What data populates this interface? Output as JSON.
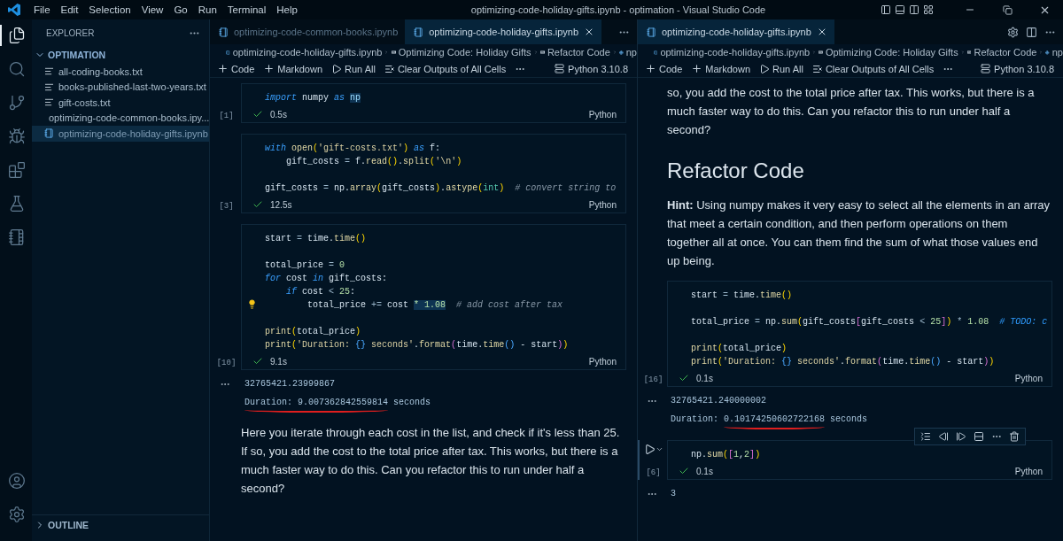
{
  "title_bar": {
    "menu": [
      "File",
      "Edit",
      "Selection",
      "View",
      "Go",
      "Run",
      "Terminal",
      "Help"
    ],
    "title": "optimizing-code-holiday-gifts.ipynb - optimation - Visual Studio Code"
  },
  "activity_bar": {
    "items": [
      {
        "kind": "explorer",
        "selected": true
      },
      {
        "kind": "search",
        "selected": false
      },
      {
        "kind": "source_control",
        "selected": false
      },
      {
        "kind": "debug",
        "selected": false
      },
      {
        "kind": "extensions",
        "selected": false
      },
      {
        "kind": "testing",
        "selected": false
      },
      {
        "kind": "notebook",
        "selected": false
      }
    ],
    "bottom": [
      {
        "kind": "account"
      },
      {
        "kind": "settings"
      }
    ]
  },
  "sidebar": {
    "title": "EXPLORER",
    "folder": {
      "name": "OPTIMATION",
      "expanded": true,
      "children": [
        {
          "name": "all-coding-books.txt",
          "kind": "text",
          "selected": false
        },
        {
          "name": "books-published-last-two-years.txt",
          "kind": "text",
          "selected": false
        },
        {
          "name": "gift-costs.txt",
          "kind": "text",
          "selected": false
        },
        {
          "name": "optimizing-code-common-books.ipy...",
          "kind": "notebook",
          "selected": false
        },
        {
          "name": "optimizing-code-holiday-gifts.ipynb",
          "kind": "notebook",
          "selected": true
        }
      ]
    },
    "sections": [
      {
        "name": "OUTLINE",
        "expanded": false
      }
    ]
  },
  "editor_groups": [
    {
      "tabs": [
        {
          "label": "optimizing-code-common-books.ipynb",
          "selected": false
        },
        {
          "label": "optimizing-code-holiday-gifts.ipynb",
          "selected": true
        }
      ],
      "tab_actions": [
        {
          "kind": "more"
        }
      ],
      "breadcrumbs": [
        {
          "label": "optimizing-code-holiday-gifts.ipynb",
          "kind": "file"
        },
        {
          "label": "Optimizing Code: Holiday Gifts",
          "kind": "markdown"
        },
        {
          "label": "Refactor Code",
          "kind": "markdown"
        },
        {
          "label": "np",
          "kind": "python"
        }
      ],
      "toolbar": {
        "buttons": [
          {
            "label": "Code",
            "kind": "add"
          },
          {
            "label": "Markdown",
            "kind": "add"
          },
          {
            "label": "Run All",
            "kind": "run"
          },
          {
            "label": "Clear Outputs of All Cells",
            "kind": "clear"
          }
        ],
        "kernel": "Python 3.10.8"
      },
      "cells": [
        {
          "kind": "code",
          "focused": false,
          "execution": "[1]",
          "status": "0.5s",
          "language": "Python",
          "lines": [
            {
              "kind": "code",
              "tokens": [
                {
                  "text": "import ",
                  "kind": "kw"
                },
                {
                  "text": "numpy ",
                  "kind": "p"
                },
                {
                  "text": "as ",
                  "kind": "kw"
                },
                {
                  "text": "np",
                  "kind": "var",
                  "highlighted": true
                }
              ]
            }
          ]
        },
        {
          "kind": "code",
          "focused": false,
          "execution": "[3]",
          "status": "12.5s",
          "language": "Python",
          "lines": [
            {
              "kind": "code",
              "tokens": [
                {
                  "text": "with ",
                  "kind": "kw"
                },
                {
                  "text": "open",
                  "kind": "fn"
                },
                {
                  "text": "(",
                  "kind": "br"
                },
                {
                  "text": "'gift-costs.txt'",
                  "kind": "str"
                },
                {
                  "text": ") ",
                  "kind": "br"
                },
                {
                  "text": "as ",
                  "kind": "kw"
                },
                {
                  "text": "f:",
                  "kind": "p"
                }
              ]
            },
            {
              "kind": "code",
              "tokens": [
                {
                  "text": "    gift_costs ",
                  "kind": "p"
                },
                {
                  "text": "=",
                  "kind": "op"
                },
                {
                  "text": " f.",
                  "kind": "p"
                },
                {
                  "text": "read",
                  "kind": "fn"
                },
                {
                  "text": "()",
                  "kind": "br"
                },
                {
                  "text": ".",
                  "kind": "p"
                },
                {
                  "text": "split",
                  "kind": "fn"
                },
                {
                  "text": "(",
                  "kind": "br"
                },
                {
                  "text": "'\\n'",
                  "kind": "str"
                },
                {
                  "text": ")",
                  "kind": "br"
                }
              ]
            },
            {
              "kind": "blank"
            },
            {
              "kind": "code",
              "tokens": [
                {
                  "text": "gift_costs ",
                  "kind": "p"
                },
                {
                  "text": "=",
                  "kind": "op"
                },
                {
                  "text": " np.",
                  "kind": "p"
                },
                {
                  "text": "array",
                  "kind": "fn"
                },
                {
                  "text": "(",
                  "kind": "br"
                },
                {
                  "text": "gift_costs",
                  "kind": "p"
                },
                {
                  "text": ")",
                  "kind": "br"
                },
                {
                  "text": ".",
                  "kind": "p"
                },
                {
                  "text": "astype",
                  "kind": "fn"
                },
                {
                  "text": "(",
                  "kind": "br"
                },
                {
                  "text": "int",
                  "kind": "cls"
                },
                {
                  "text": ")",
                  "kind": "br"
                },
                {
                  "text": "  # convert string to",
                  "kind": "com"
                }
              ]
            }
          ]
        },
        {
          "kind": "code",
          "focused": false,
          "execution": "[10]",
          "status": "9.1s",
          "language": "Python",
          "lines": [
            {
              "kind": "code",
              "tokens": [
                {
                  "text": "start ",
                  "kind": "p"
                },
                {
                  "text": "=",
                  "kind": "op"
                },
                {
                  "text": " time.",
                  "kind": "p"
                },
                {
                  "text": "time",
                  "kind": "fn"
                },
                {
                  "text": "()",
                  "kind": "br"
                }
              ]
            },
            {
              "kind": "blank"
            },
            {
              "kind": "code",
              "tokens": [
                {
                  "text": "total_price ",
                  "kind": "p"
                },
                {
                  "text": "=",
                  "kind": "op"
                },
                {
                  "text": " 0",
                  "kind": "num"
                }
              ]
            },
            {
              "kind": "code",
              "tokens": [
                {
                  "text": "for ",
                  "kind": "kw"
                },
                {
                  "text": "cost ",
                  "kind": "p"
                },
                {
                  "text": "in ",
                  "kind": "kw"
                },
                {
                  "text": "gift_costs:",
                  "kind": "p"
                }
              ]
            },
            {
              "kind": "code",
              "tokens": [
                {
                  "text": "    if ",
                  "kind": "kw"
                },
                {
                  "text": "cost ",
                  "kind": "p"
                },
                {
                  "text": "<",
                  "kind": "op"
                },
                {
                  "text": " 25",
                  "kind": "num"
                },
                {
                  "text": ":",
                  "kind": "p"
                }
              ]
            },
            {
              "kind": "code",
              "lightbulb": true,
              "tokens": [
                {
                  "text": "        total_price ",
                  "kind": "p"
                },
                {
                  "text": "+=",
                  "kind": "op"
                },
                {
                  "text": " cost ",
                  "kind": "p"
                },
                {
                  "text": "* 1.08",
                  "kind": "num",
                  "highlighted": true
                },
                {
                  "text": "  # add cost after tax",
                  "kind": "com"
                }
              ]
            },
            {
              "kind": "blank"
            },
            {
              "kind": "code",
              "tokens": [
                {
                  "text": "print",
                  "kind": "fn"
                },
                {
                  "text": "(",
                  "kind": "br"
                },
                {
                  "text": "total_price",
                  "kind": "p"
                },
                {
                  "text": ")",
                  "kind": "br"
                }
              ]
            },
            {
              "kind": "code",
              "tokens": [
                {
                  "text": "print",
                  "kind": "fn"
                },
                {
                  "text": "(",
                  "kind": "br"
                },
                {
                  "text": "'Duration: ",
                  "kind": "str"
                },
                {
                  "text": "{}",
                  "kind": "br3"
                },
                {
                  "text": " seconds'",
                  "kind": "str"
                },
                {
                  "text": ".",
                  "kind": "p"
                },
                {
                  "text": "format",
                  "kind": "fn"
                },
                {
                  "text": "(",
                  "kind": "br2"
                },
                {
                  "text": "time.",
                  "kind": "p"
                },
                {
                  "text": "time",
                  "kind": "fn"
                },
                {
                  "text": "()",
                  "kind": "br3"
                },
                {
                  "text": " - start",
                  "kind": "p"
                },
                {
                  "text": ")",
                  "kind": "br2"
                },
                {
                  "text": ")",
                  "kind": "br"
                }
              ]
            }
          ],
          "outputs": [
            {
              "segments": [
                {
                  "text": "32765421.23999867",
                  "underlined": false
                }
              ]
            },
            {
              "segments": [
                {
                  "text": "Duration: 9.007362842559814",
                  "underlined": true
                },
                {
                  "text": " seconds",
                  "underlined": false
                }
              ]
            }
          ]
        },
        {
          "kind": "markdown",
          "blocks": [
            {
              "kind": "paragraph",
              "text": "Here you iterate through each cost in the list, and check if it's less than 25. If so, you add the cost to the total price after tax. This works, but there is a much faster way to do this. Can you refactor this to run under half a second?"
            }
          ]
        }
      ]
    },
    {
      "tabs": [
        {
          "label": "optimizing-code-holiday-gifts.ipynb",
          "selected": true
        }
      ],
      "tab_actions": [
        {
          "kind": "settings"
        },
        {
          "kind": "split"
        },
        {
          "kind": "more"
        }
      ],
      "breadcrumbs": [
        {
          "label": "optimizing-code-holiday-gifts.ipynb",
          "kind": "file"
        },
        {
          "label": "Optimizing Code: Holiday Gifts",
          "kind": "markdown"
        },
        {
          "label": "Refactor Code",
          "kind": "markdown"
        },
        {
          "label": "np",
          "kind": "python"
        }
      ],
      "toolbar": {
        "buttons": [
          {
            "label": "Code",
            "kind": "add"
          },
          {
            "label": "Markdown",
            "kind": "add"
          },
          {
            "label": "Run All",
            "kind": "run"
          },
          {
            "label": "Clear Outputs of All Cells",
            "kind": "clear"
          }
        ],
        "kernel": "Python 3.10.8"
      },
      "cells": [
        {
          "kind": "markdown",
          "blocks": [
            {
              "kind": "paragraph",
              "text": "so, you add the cost to the total price after tax. This works, but there is a much faster way to do this. Can you refactor this to run under half a second?"
            },
            {
              "kind": "heading",
              "text": "Refactor Code"
            },
            {
              "kind": "paragraph",
              "text": "**Hint:** Using numpy makes it very easy to select all the elements in an array that meet a certain condition, and then perform operations on them together all at once. You can them find the sum of what those values end up being."
            }
          ]
        },
        {
          "kind": "code",
          "focused": false,
          "execution": "[16]",
          "status": "0.1s",
          "language": "Python",
          "lines": [
            {
              "kind": "code",
              "tokens": [
                {
                  "text": "start ",
                  "kind": "p"
                },
                {
                  "text": "=",
                  "kind": "op"
                },
                {
                  "text": " time.",
                  "kind": "p"
                },
                {
                  "text": "time",
                  "kind": "fn"
                },
                {
                  "text": "()",
                  "kind": "br"
                }
              ]
            },
            {
              "kind": "blank"
            },
            {
              "kind": "code",
              "tokens": [
                {
                  "text": "total_price ",
                  "kind": "p"
                },
                {
                  "text": "=",
                  "kind": "op"
                },
                {
                  "text": " np.",
                  "kind": "p"
                },
                {
                  "text": "sum",
                  "kind": "fn"
                },
                {
                  "text": "(",
                  "kind": "br"
                },
                {
                  "text": "gift_costs",
                  "kind": "p"
                },
                {
                  "text": "[",
                  "kind": "br2"
                },
                {
                  "text": "gift_costs ",
                  "kind": "p"
                },
                {
                  "text": "<",
                  "kind": "op"
                },
                {
                  "text": " 25",
                  "kind": "num"
                },
                {
                  "text": "]",
                  "kind": "br2"
                },
                {
                  "text": ")",
                  "kind": "br"
                },
                {
                  "text": " * ",
                  "kind": "op"
                },
                {
                  "text": "1.08",
                  "kind": "num"
                },
                {
                  "text": "  # TODO: c",
                  "kind": "todo"
                }
              ]
            },
            {
              "kind": "blank"
            },
            {
              "kind": "code",
              "tokens": [
                {
                  "text": "print",
                  "kind": "fn"
                },
                {
                  "text": "(",
                  "kind": "br"
                },
                {
                  "text": "total_price",
                  "kind": "p"
                },
                {
                  "text": ")",
                  "kind": "br"
                }
              ]
            },
            {
              "kind": "code",
              "tokens": [
                {
                  "text": "print",
                  "kind": "fn"
                },
                {
                  "text": "(",
                  "kind": "br"
                },
                {
                  "text": "'Duration: ",
                  "kind": "str"
                },
                {
                  "text": "{}",
                  "kind": "br3"
                },
                {
                  "text": " seconds'",
                  "kind": "str"
                },
                {
                  "text": ".",
                  "kind": "p"
                },
                {
                  "text": "format",
                  "kind": "fn"
                },
                {
                  "text": "(",
                  "kind": "br2"
                },
                {
                  "text": "time.",
                  "kind": "p"
                },
                {
                  "text": "time",
                  "kind": "fn"
                },
                {
                  "text": "()",
                  "kind": "br3"
                },
                {
                  "text": " - start",
                  "kind": "p"
                },
                {
                  "text": ")",
                  "kind": "br2"
                },
                {
                  "text": ")",
                  "kind": "br"
                }
              ]
            }
          ],
          "outputs": [
            {
              "segments": [
                {
                  "text": "32765421.240000002",
                  "underlined": false
                }
              ]
            },
            {
              "segments": [
                {
                  "text": "Duration: ",
                  "underlined": false
                },
                {
                  "text": "0.10174250602722168",
                  "underlined": true
                },
                {
                  "text": " seconds",
                  "underlined": false
                }
              ]
            }
          ]
        },
        {
          "kind": "code",
          "focused": true,
          "execution": "[6]",
          "status": "0.1s",
          "language": "Python",
          "lines": [
            {
              "kind": "code",
              "tokens": [
                {
                  "text": "np.",
                  "kind": "p"
                },
                {
                  "text": "sum",
                  "kind": "fn"
                },
                {
                  "text": "(",
                  "kind": "br"
                },
                {
                  "text": "[",
                  "kind": "br2"
                },
                {
                  "text": "1",
                  "kind": "num"
                },
                {
                  "text": ",",
                  "kind": "p"
                },
                {
                  "text": "2",
                  "kind": "num"
                },
                {
                  "text": "]",
                  "kind": "br2"
                },
                {
                  "text": ")",
                  "kind": "br"
                }
              ]
            }
          ],
          "outputs": [
            {
              "segments": [
                {
                  "text": "3",
                  "underlined": false
                }
              ]
            }
          ]
        }
      ]
    }
  ]
}
